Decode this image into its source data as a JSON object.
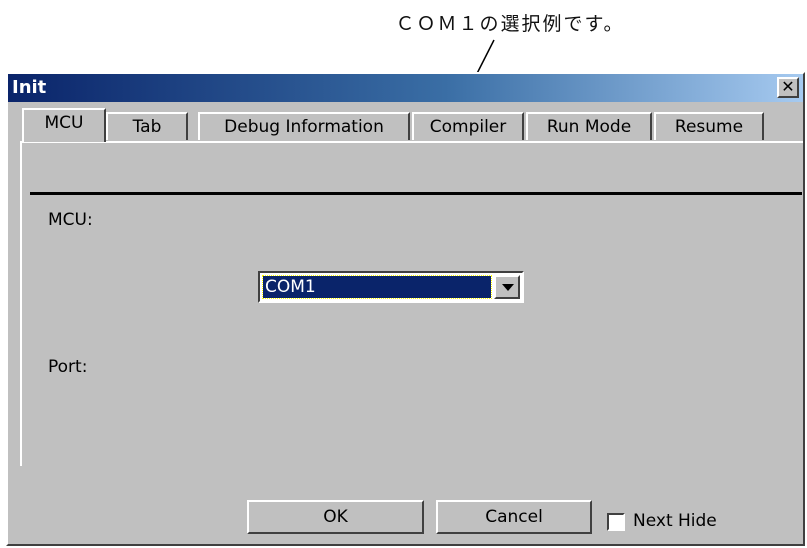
{
  "annotation": {
    "text": "ＣＯＭ１の選択例です。"
  },
  "window": {
    "title": "Init",
    "close_glyph": "✕"
  },
  "tabs": [
    {
      "label": "MCU",
      "active": true
    },
    {
      "label": "Tab"
    },
    {
      "label": "Debug Information"
    },
    {
      "label": "Compiler"
    },
    {
      "label": "Run Mode"
    },
    {
      "label": "Resume"
    }
  ],
  "mcu": {
    "label": "MCU:"
  },
  "port": {
    "label": "Port:",
    "selected": "COM1"
  },
  "buttons": {
    "ok": "OK",
    "cancel": "Cancel"
  },
  "next_hide": {
    "label": "Next Hide",
    "checked": false
  },
  "colors": {
    "title_start": "#0a246a",
    "title_end": "#a6caf0",
    "face": "#c0c0c0",
    "selection": "#0a246a"
  }
}
